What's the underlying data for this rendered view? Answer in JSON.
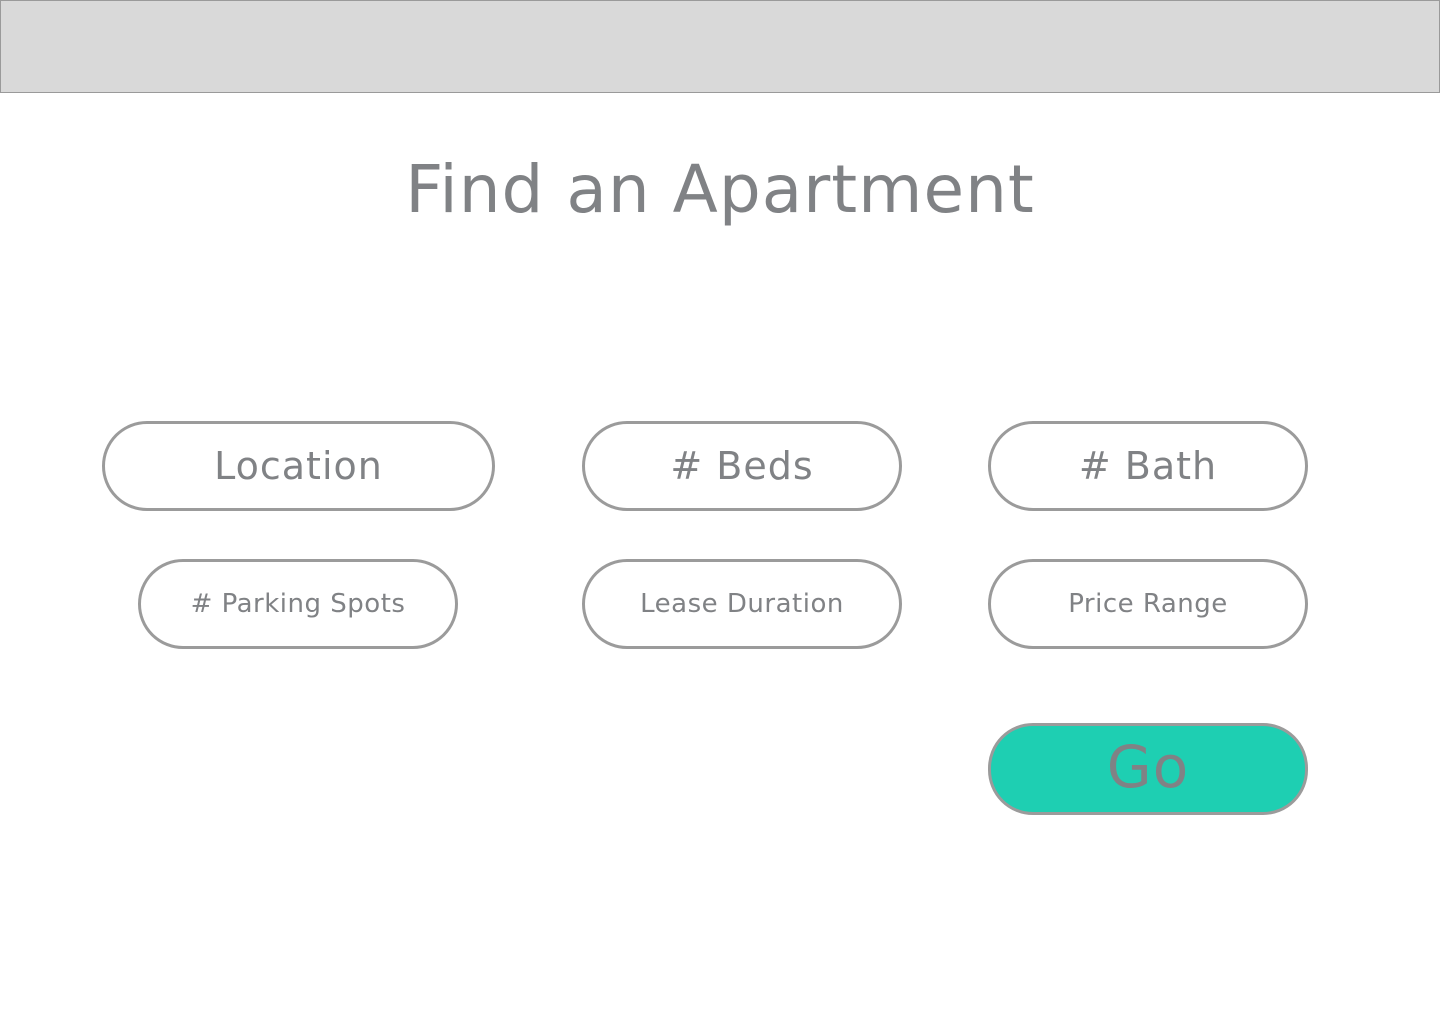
{
  "header": {
    "title": "Find an Apartment"
  },
  "filters": {
    "location": "Location",
    "beds": "# Beds",
    "bath": "# Bath",
    "parking": "# Parking Spots",
    "lease": "Lease Duration",
    "price": "Price Range"
  },
  "actions": {
    "go_label": "Go"
  },
  "colors": {
    "accent": "#1ecfb2",
    "top_bar": "#d9d9d9",
    "text": "#808285",
    "border": "#9b9b9b"
  }
}
